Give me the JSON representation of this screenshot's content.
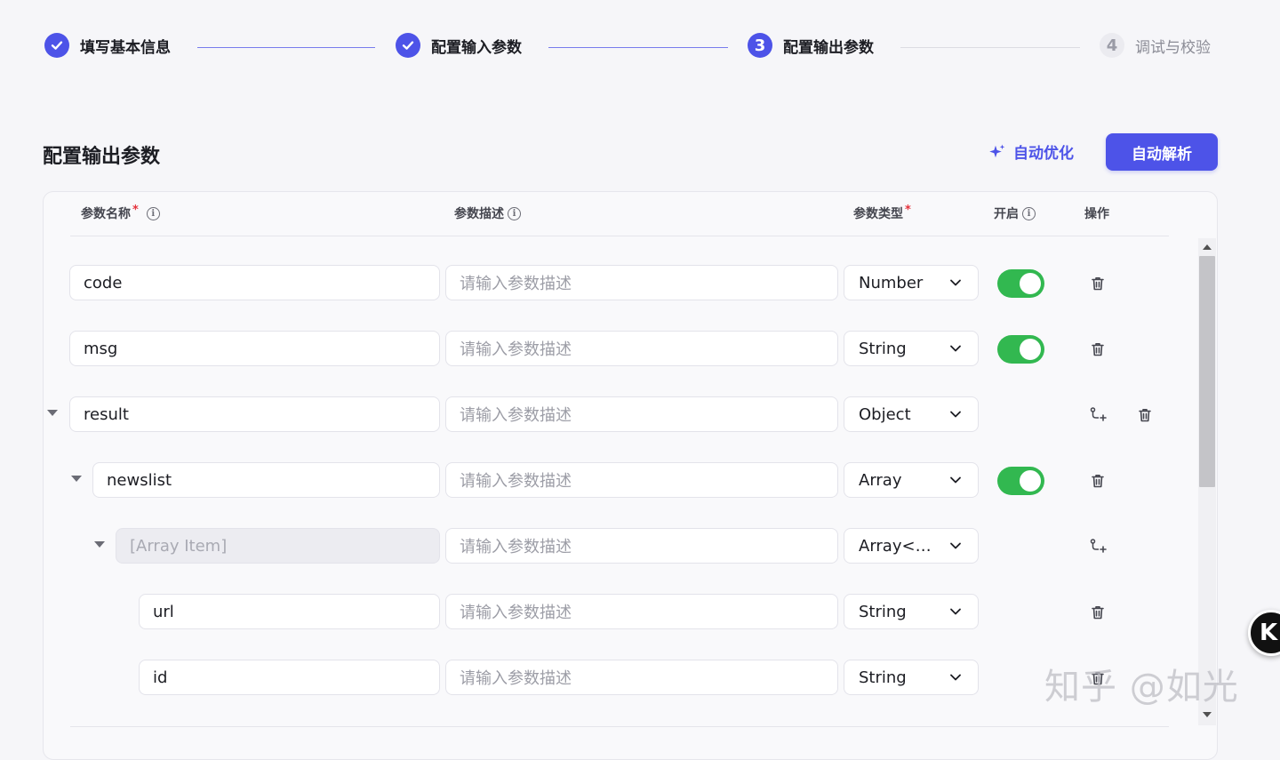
{
  "stepper": {
    "steps": [
      {
        "number": "1",
        "title": "填写基本信息",
        "status": "done"
      },
      {
        "number": "2",
        "title": "配置输入参数",
        "status": "done"
      },
      {
        "number": "3",
        "title": "配置输出参数",
        "status": "active"
      },
      {
        "number": "4",
        "title": "调试与校验",
        "status": "pending"
      }
    ]
  },
  "section": {
    "title": "配置输出参数",
    "optimize_label": "自动优化",
    "parse_label": "自动解析"
  },
  "table": {
    "headers": {
      "name": "参数名称",
      "description": "参数描述",
      "type": "参数类型",
      "enabled": "开启",
      "actions": "操作"
    },
    "required_mark": "*",
    "rows": [
      {
        "name": "code",
        "description_placeholder": "请输入参数描述",
        "type": "Number",
        "enabled": true
      },
      {
        "name": "msg",
        "description_placeholder": "请输入参数描述",
        "type": "String",
        "enabled": true
      },
      {
        "name": "result",
        "description_placeholder": "请输入参数描述",
        "type": "Object",
        "expanded": true
      },
      {
        "name": "newslist",
        "description_placeholder": "请输入参数描述",
        "type": "Array",
        "enabled": true,
        "expanded": true
      },
      {
        "name": "[Array Item]",
        "description_placeholder": "请输入参数描述",
        "type": "Array<…",
        "disabled": true,
        "expanded": true
      },
      {
        "name": "url",
        "description_placeholder": "请输入参数描述",
        "type": "String"
      },
      {
        "name": "id",
        "description_placeholder": "请输入参数描述",
        "type": "String"
      }
    ]
  },
  "floating_badge": {
    "label": "K"
  },
  "watermark": {
    "text": "知乎 @如光"
  },
  "colors": {
    "primary": "#4d53e8",
    "toggle_on": "#32b850",
    "required": "#e5323c"
  }
}
